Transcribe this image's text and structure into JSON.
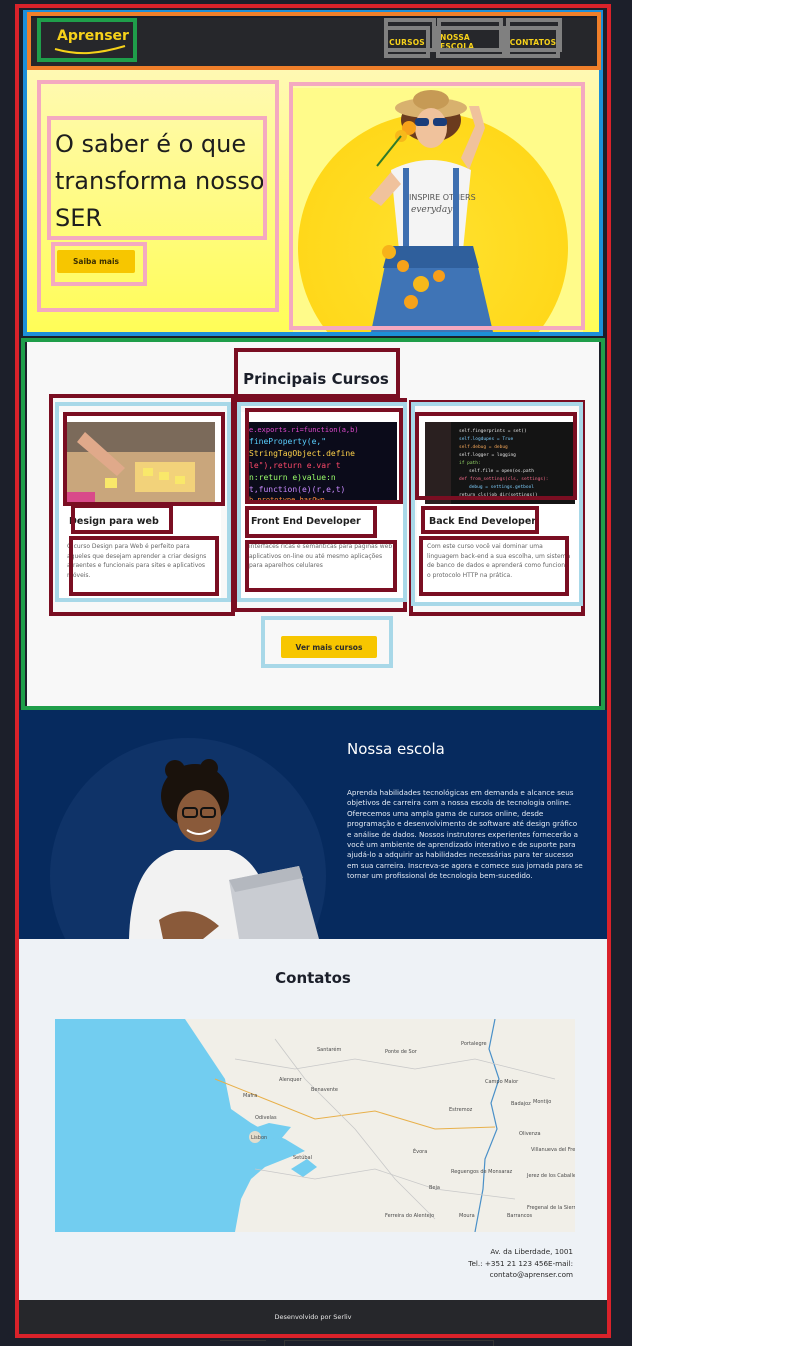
{
  "header": {
    "logo_text": "Aprenser",
    "nav": [
      "CURSOS",
      "NOSSA ESCOLA",
      "CONTATOS"
    ]
  },
  "hero": {
    "title": "O saber é o que transforma nosso SER",
    "button": "Saiba mais"
  },
  "courses": {
    "title": "Principais Cursos",
    "cards": [
      {
        "title": "Design para web",
        "desc": "O curso Design para Web é perfeito para aqueles que desejam aprender a criar designs atraentes e funcionais para sites e aplicativos móveis."
      },
      {
        "title": "Front End Developer",
        "desc": "interfaces ricas e semânticas para páginas web aplicativos on-line ou até mesmo aplicações para aparelhos celulares"
      },
      {
        "title": "Back End Developer",
        "desc": "Com este curso você vai dominar uma linguagem back-end a sua escolha, um sistema de banco de dados e aprenderá como funciona o protocolo HTTP na prática."
      }
    ],
    "more_button": "Ver mais cursos"
  },
  "school": {
    "title": "Nossa escola",
    "text": "Aprenda habilidades tecnológicas em demanda e alcance seus objetivos de carreira com a nossa escola de tecnologia online. Oferecemos uma ampla gama de cursos online, desde programação e desenvolvimento de software até design gráfico e análise de dados. Nossos instrutores experientes fornecerão a você um ambiente de aprendizado interativo e de suporte para ajudá-lo a adquirir as habilidades necessárias para ter sucesso em sua carreira. Inscreva-se agora e comece sua jornada para se tornar um profissional de tecnologia bem-sucedido."
  },
  "contacts": {
    "title": "Contatos",
    "map_labels": [
      "Santarém",
      "Ponte de Sor",
      "Portalegre",
      "Alenquer",
      "Benavente",
      "Campo Maior",
      "Badajoz",
      "Montijo",
      "Mafra",
      "Estremoz",
      "Odivelas",
      "Lisbon",
      "Olivenza",
      "Évora",
      "Setúbal",
      "Reguengos de Monsaraz",
      "Villanueva del Fresno",
      "Jerez de los Caballeros",
      "Fregenal de la Sierra",
      "Barrancos",
      "Moura",
      "Ferreira do Alentejo",
      "Beja"
    ],
    "address_line1": "Av. da Liberdade, 1001",
    "address_line2": "Tel.: +351 21 123 456E-mail:",
    "address_line3": "contato@aprenser.com"
  },
  "footer": {
    "text": "Desenvolvido por Serliv"
  },
  "colors": {
    "accent": "#f7c600",
    "header_bg": "#26272b",
    "school_bg": "#062a5e"
  }
}
